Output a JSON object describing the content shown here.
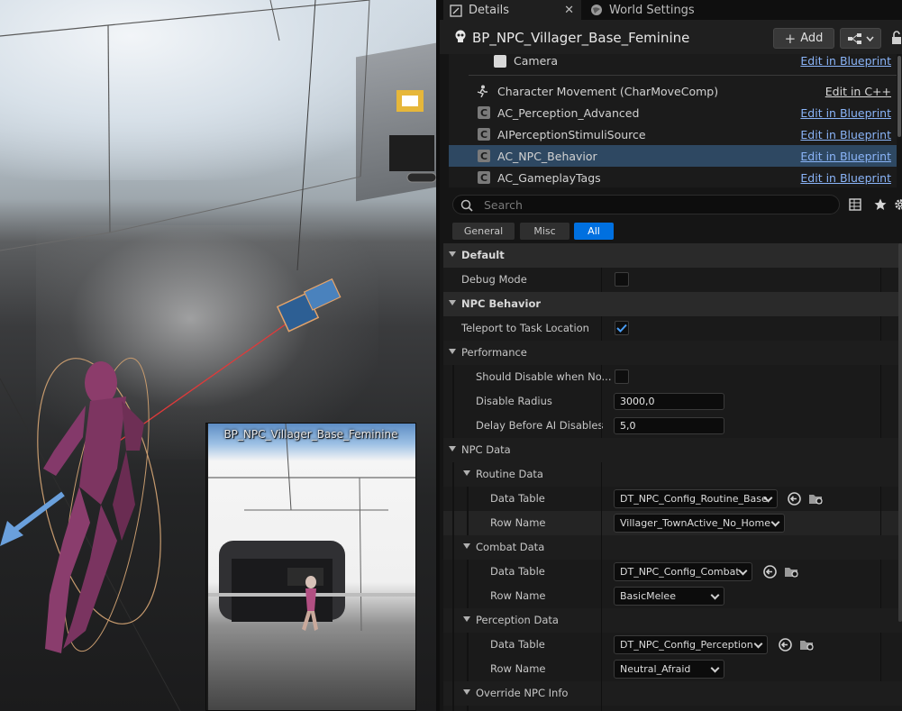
{
  "viewport": {
    "preview_title": "BP_NPC_Villager_Base_Feminine"
  },
  "tabs": [
    {
      "label": "Details",
      "icon": "details-icon"
    },
    {
      "label": "World Settings",
      "icon": "globe-icon"
    }
  ],
  "header": {
    "actor_name": "BP_NPC_Villager_Base_Feminine",
    "add_label": "Add",
    "actor_icon": "skull-icon"
  },
  "components": [
    {
      "label": "Camera",
      "action": "Edit in Blueprint",
      "icon": "camera-icon"
    },
    {
      "label": "Character Movement (CharMoveComp)",
      "action": "Edit in C++",
      "icon": "movement-icon"
    },
    {
      "label": "AC_Perception_Advanced",
      "action": "Edit in Blueprint",
      "icon": "component-icon"
    },
    {
      "label": "AIPerceptionStimuliSource",
      "action": "Edit in Blueprint",
      "icon": "component-icon"
    },
    {
      "label": "AC_NPC_Behavior",
      "action": "Edit in Blueprint",
      "icon": "component-icon",
      "selected": true
    },
    {
      "label": "AC_GameplayTags",
      "action": "Edit in Blueprint",
      "icon": "component-icon"
    }
  ],
  "search": {
    "placeholder": "Search"
  },
  "filters": [
    "General",
    "Misc",
    "All"
  ],
  "active_filter": "All",
  "properties": {
    "default": {
      "label": "Default",
      "debug_mode": "Debug Mode",
      "debug_mode_value": false
    },
    "npc_behavior": {
      "label": "NPC Behavior",
      "teleport": "Teleport to Task Location",
      "teleport_value": true
    },
    "performance": {
      "label": "Performance",
      "should_disable": "Should Disable when No...",
      "should_disable_value": false,
      "disable_radius": "Disable Radius",
      "disable_radius_value": "3000,0",
      "delay": "Delay Before AI Disables",
      "delay_value": "5,0"
    },
    "npc_data": {
      "label": "NPC Data",
      "routine": {
        "label": "Routine Data",
        "data_table": "Data Table",
        "data_table_value": "DT_NPC_Config_Routine_Base",
        "row_name": "Row Name",
        "row_name_value": "Villager_TownActive_No_Home"
      },
      "combat": {
        "label": "Combat Data",
        "data_table": "Data Table",
        "data_table_value": "DT_NPC_Config_Combat",
        "row_name": "Row Name",
        "row_name_value": "BasicMelee"
      },
      "perception": {
        "label": "Perception Data",
        "data_table": "Data Table",
        "data_table_value": "DT_NPC_Config_Perception",
        "row_name": "Row Name",
        "row_name_value": "Neutral_Afraid"
      },
      "override": {
        "label": "Override NPC Info"
      }
    }
  },
  "colors": {
    "accent": "#0070e0",
    "selection": "#2e4862",
    "link": "#8ab4f8"
  }
}
